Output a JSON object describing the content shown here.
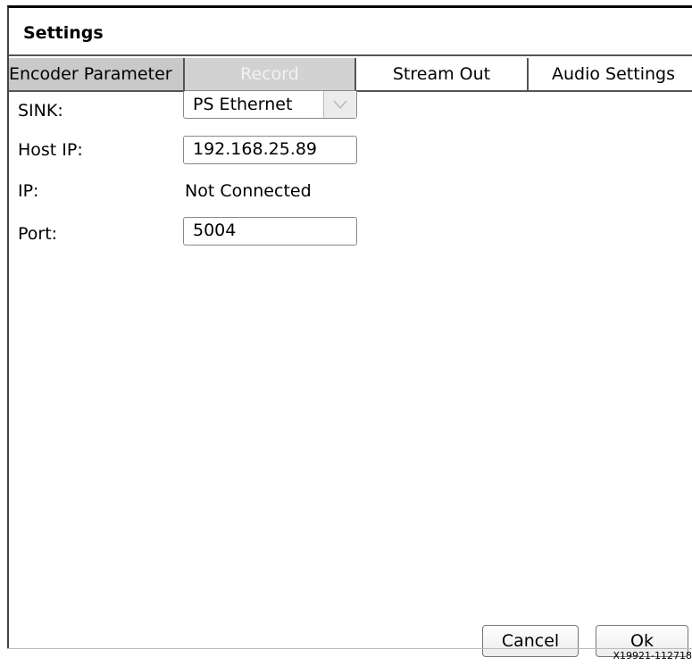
{
  "window": {
    "title": "Settings"
  },
  "tabs": [
    {
      "label": "Encoder Parameter",
      "state": "selected"
    },
    {
      "label": "Record",
      "state": "disabled"
    },
    {
      "label": "Stream Out",
      "state": "normal"
    },
    {
      "label": "Audio Settings",
      "state": "normal"
    }
  ],
  "fields": {
    "sink": {
      "label": "SINK:",
      "value": "PS Ethernet",
      "icon": "chevron-down-icon"
    },
    "host_ip": {
      "label": "Host IP:",
      "value": "192.168.25.89"
    },
    "ip": {
      "label": "IP:",
      "value": "Not Connected"
    },
    "port": {
      "label": "Port:",
      "value": "5004"
    }
  },
  "buttons": {
    "cancel": "Cancel",
    "ok": "Ok"
  },
  "figure_id": "X19921-112718"
}
